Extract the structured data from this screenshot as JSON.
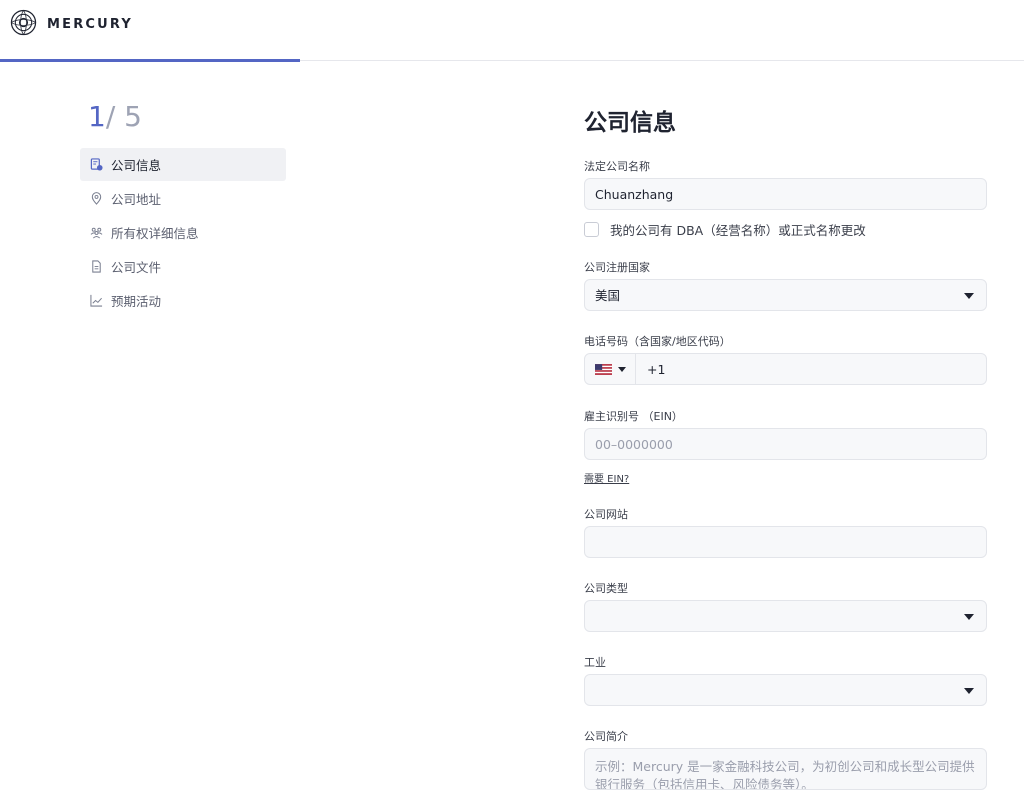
{
  "brand": {
    "name": "MERCURY"
  },
  "progress": {
    "fraction": 0.2
  },
  "steps": {
    "current": "1",
    "separator": "/",
    "total": "5"
  },
  "sidebar": {
    "items": [
      {
        "label": "公司信息",
        "icon": "document-person-icon",
        "active": true
      },
      {
        "label": "公司地址",
        "icon": "location-pin-icon",
        "active": false
      },
      {
        "label": "所有权详细信息",
        "icon": "people-icon",
        "active": false
      },
      {
        "label": "公司文件",
        "icon": "file-icon",
        "active": false
      },
      {
        "label": "预期活动",
        "icon": "line-chart-icon",
        "active": false
      }
    ]
  },
  "form": {
    "title": "公司信息",
    "legal_name": {
      "label": "法定公司名称",
      "value": "Chuanzhang"
    },
    "dba": {
      "label": "我的公司有 DBA（经营名称）或正式名称更改",
      "checked": false
    },
    "country": {
      "label": "公司注册国家",
      "value": "美国"
    },
    "phone": {
      "label": "电话号码（含国家/地区代码）",
      "flag": "us-flag-icon",
      "value": "+1"
    },
    "ein": {
      "label": "雇主识别号 （EIN）",
      "placeholder": "00–0000000",
      "help_link": "需要 EIN?"
    },
    "website": {
      "label": "公司网站",
      "value": ""
    },
    "company_type": {
      "label": "公司类型",
      "value": ""
    },
    "industry": {
      "label": "工业",
      "value": ""
    },
    "description": {
      "label": "公司简介",
      "placeholder": "示例：Mercury 是一家金融科技公司，为初创公司和成长型公司提供银行服务（包括信用卡、风险债务等）。"
    }
  },
  "colors": {
    "accent": "#5466c4",
    "field_bg": "#f7f8fa",
    "border": "#e3e5ea"
  }
}
